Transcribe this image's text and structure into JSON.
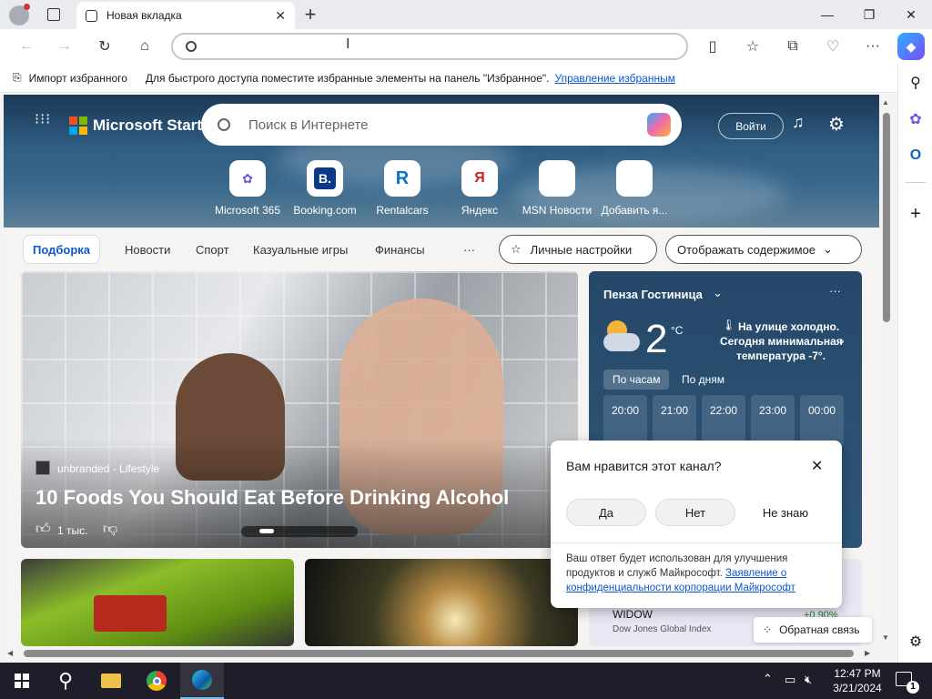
{
  "browser": {
    "tab_title": "Новая вкладка",
    "new_tab_symbol": "+",
    "address_placeholder": ""
  },
  "favorites_bar": {
    "import": "Импорт избранного",
    "hint": "Для быстрого доступа поместите избранные элементы на панель \"Избранное\".",
    "manage_link": "Управление избранным"
  },
  "msn": {
    "brand": "Microsoft Start",
    "search_placeholder": "Поиск в Интернете",
    "signin": "Войти",
    "quick_links": [
      {
        "label": "Microsoft 365",
        "glyph": "✿",
        "color": "#7a4ee0"
      },
      {
        "label": "Booking.com",
        "glyph": "B.",
        "color": "#0b3a8a"
      },
      {
        "label": "Rentalcars",
        "glyph": "R",
        "color": "#0b70d0"
      },
      {
        "label": "Яндекс",
        "glyph": "Я",
        "color": "#d21f1f"
      },
      {
        "label": "MSN Новости",
        "glyph": "▤",
        "color": "#222"
      },
      {
        "label": "Добавить я...",
        "glyph": "+",
        "color": "#333"
      }
    ],
    "feed_tabs": [
      "Подборка",
      "Новости",
      "Спорт",
      "Казуальные игры",
      "Финансы"
    ],
    "more": "···",
    "personalize": "Личные настройки",
    "display_content": "Отображать содержимое"
  },
  "main_story": {
    "source": "unbranded - Lifestyle",
    "headline": "10 Foods You Should Eat Before Drinking Alcohol",
    "likes": "1 тыс."
  },
  "weather": {
    "location": "Пенза Гостиница",
    "temp": "2",
    "unit": "°C",
    "note_line1": "На улице холодно.",
    "note_line2": "Сегодня минимальная",
    "note_line3": "температура -7°.",
    "tab_hourly": "По часам",
    "tab_daily": "По дням",
    "hours": [
      "20:00",
      "21:00",
      "22:00",
      "23:00",
      "00:00"
    ]
  },
  "popup": {
    "question": "Вам нравится этот канал?",
    "yes": "Да",
    "no": "Нет",
    "dont_know": "Не знаю",
    "footer_text": "Ваш ответ будет использован для улучшения продуктов и служб Майкрософт.",
    "privacy_link_line1": "Заявление о",
    "privacy_link_line2": "конфиденциальности корпорации Майкрософт"
  },
  "stock": {
    "symbol": "WIDOW",
    "name": "Dow Jones Global Index",
    "change": "+0.90%"
  },
  "feedback": "Обратная связь",
  "taskbar": {
    "time": "12:47 PM",
    "date": "3/21/2024",
    "notification_count": "1"
  }
}
